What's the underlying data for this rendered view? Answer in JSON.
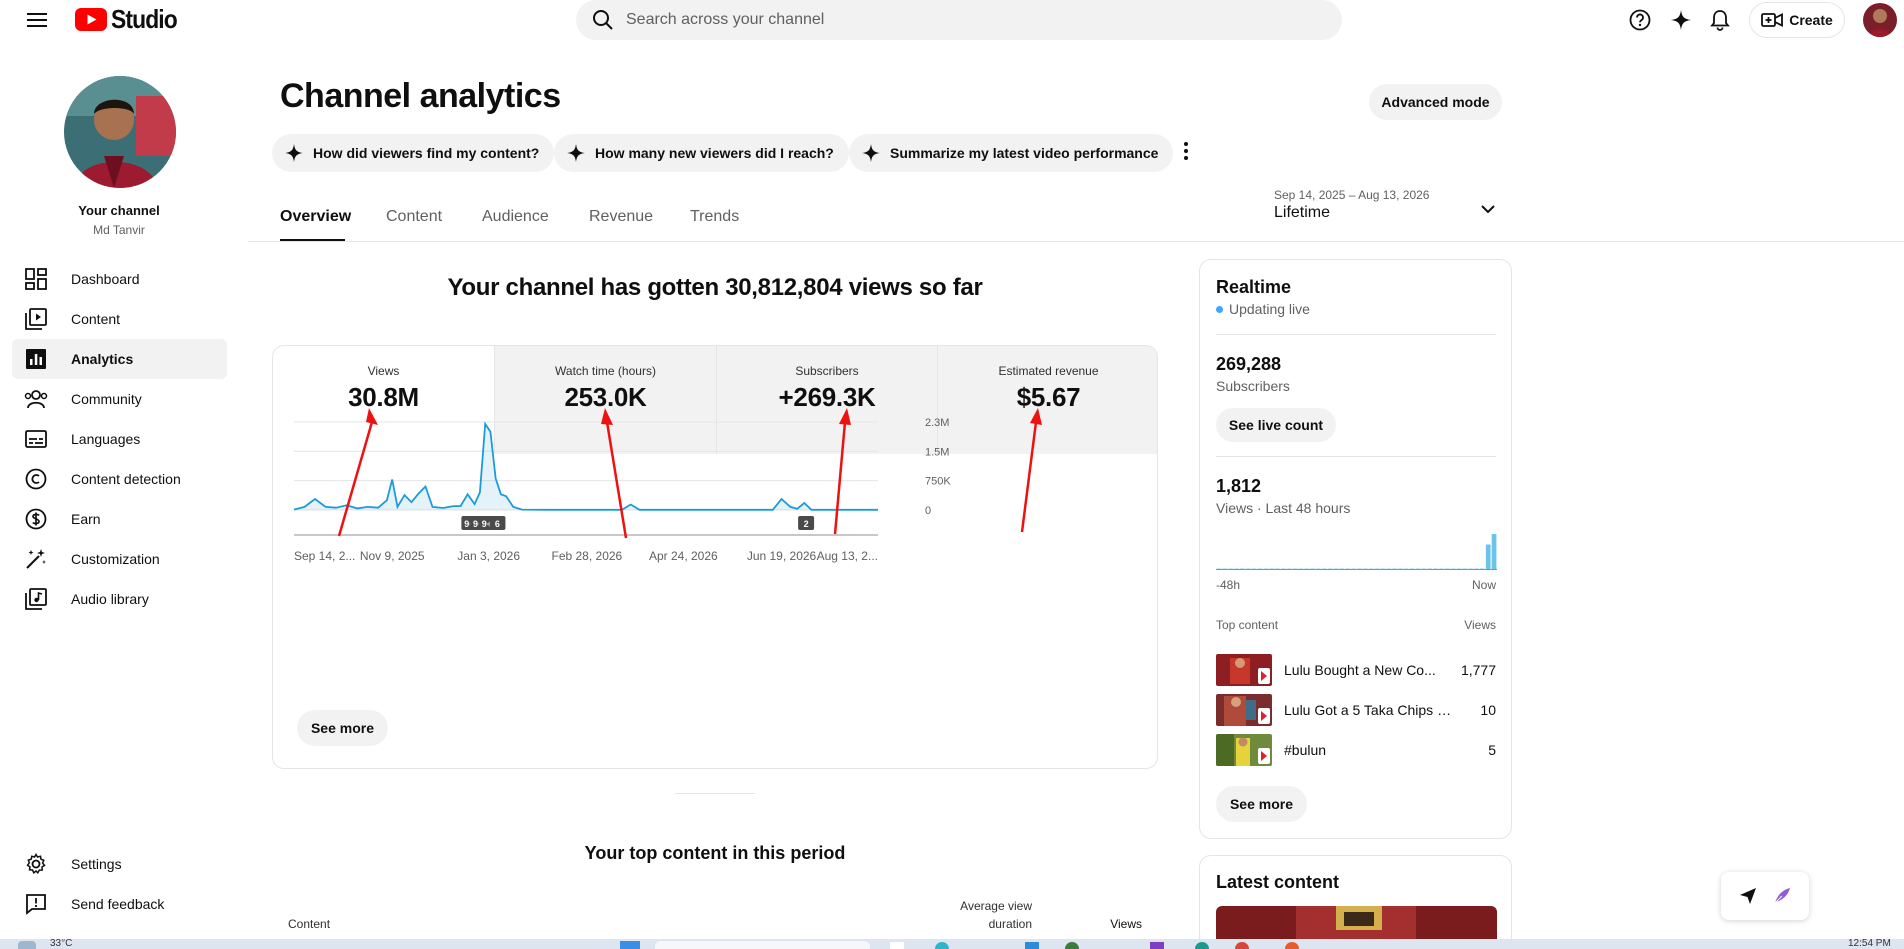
{
  "header": {
    "logo_text": "Studio",
    "search_placeholder": "Search across your channel",
    "create_label": "Create"
  },
  "sidebar": {
    "your_channel": "Your channel",
    "channel_name": "Md Tanvir",
    "items": [
      {
        "label": "Dashboard",
        "icon": "dashboard-icon"
      },
      {
        "label": "Content",
        "icon": "content-icon"
      },
      {
        "label": "Analytics",
        "icon": "analytics-icon",
        "active": true
      },
      {
        "label": "Community",
        "icon": "community-icon"
      },
      {
        "label": "Languages",
        "icon": "languages-icon"
      },
      {
        "label": "Content detection",
        "icon": "copyright-icon"
      },
      {
        "label": "Earn",
        "icon": "dollar-icon"
      },
      {
        "label": "Customization",
        "icon": "magic-wand-icon"
      },
      {
        "label": "Audio library",
        "icon": "audio-library-icon"
      }
    ],
    "settings": "Settings",
    "send_feedback": "Send feedback"
  },
  "main": {
    "title": "Channel analytics",
    "advanced_mode": "Advanced mode",
    "chips": [
      "How did viewers find my content?",
      "How many new viewers did I reach?",
      "Summarize my latest video performance"
    ],
    "tabs": [
      "Overview",
      "Content",
      "Audience",
      "Revenue",
      "Trends"
    ],
    "date_range": "Sep 14, 2025 – Aug 13, 2026",
    "date_label": "Lifetime",
    "headline": "Your channel has gotten 30,812,804 views so far",
    "metrics": [
      {
        "label": "Views",
        "value": "30.8M"
      },
      {
        "label": "Watch time (hours)",
        "value": "253.0K"
      },
      {
        "label": "Subscribers",
        "value": "+269.3K"
      },
      {
        "label": "Estimated revenue",
        "value": "$5.67"
      }
    ],
    "see_more": "See more",
    "top_content_title": "Your top content in this period",
    "table_headers": {
      "content": "Content",
      "avg_duration_1": "Average view",
      "avg_duration_2": "duration",
      "views": "Views"
    }
  },
  "chart_data": {
    "type": "line",
    "x_tick_labels": [
      "Sep 14, 2...",
      "Nov 9, 2025",
      "Jan 3, 2026",
      "Feb 28, 2026",
      "Apr 24, 2026",
      "Jun 19, 2026",
      "Aug 13, 2..."
    ],
    "y_tick_labels": [
      "0",
      "750K",
      "1.5M",
      "2.3M"
    ],
    "ylim": [
      0,
      2300000
    ],
    "series": [
      {
        "color": "#1e9bd7",
        "points": [
          [
            "2025-09-14",
            10000
          ],
          [
            "2025-09-20",
            80000
          ],
          [
            "2025-09-26",
            280000
          ],
          [
            "2025-10-02",
            80000
          ],
          [
            "2025-10-08",
            60000
          ],
          [
            "2025-10-14",
            120000
          ],
          [
            "2025-10-20",
            40000
          ],
          [
            "2025-10-26",
            80000
          ],
          [
            "2025-11-01",
            60000
          ],
          [
            "2025-11-06",
            250000
          ],
          [
            "2025-11-09",
            780000
          ],
          [
            "2025-11-12",
            80000
          ],
          [
            "2025-11-16",
            380000
          ],
          [
            "2025-11-20",
            200000
          ],
          [
            "2025-11-24",
            420000
          ],
          [
            "2025-11-28",
            600000
          ],
          [
            "2025-12-02",
            80000
          ],
          [
            "2025-12-08",
            50000
          ],
          [
            "2025-12-14",
            100000
          ],
          [
            "2025-12-18",
            100000
          ],
          [
            "2025-12-22",
            400000
          ],
          [
            "2025-12-26",
            150000
          ],
          [
            "2025-12-29",
            450000
          ],
          [
            "2026-01-01",
            2200000
          ],
          [
            "2026-01-04",
            2000000
          ],
          [
            "2026-01-07",
            800000
          ],
          [
            "2026-01-10",
            400000
          ],
          [
            "2026-01-13",
            350000
          ],
          [
            "2026-01-17",
            80000
          ],
          [
            "2026-01-22",
            10000
          ],
          [
            "2026-02-05",
            5000
          ],
          [
            "2026-03-01",
            5000
          ],
          [
            "2026-03-20",
            5000
          ],
          [
            "2026-03-25",
            140000
          ],
          [
            "2026-03-30",
            5000
          ],
          [
            "2026-05-10",
            5000
          ],
          [
            "2026-06-14",
            5000
          ],
          [
            "2026-06-19",
            280000
          ],
          [
            "2026-06-24",
            80000
          ],
          [
            "2026-06-28",
            30000
          ],
          [
            "2026-07-02",
            180000
          ],
          [
            "2026-07-06",
            5000
          ],
          [
            "2026-08-13",
            5000
          ]
        ]
      }
    ],
    "annotations": [
      {
        "label": "9+",
        "date": "2025-12-23"
      },
      {
        "label": "9+",
        "date": "2025-12-28"
      },
      {
        "label": "9+",
        "date": "2026-01-02"
      },
      {
        "label": "6",
        "date": "2026-01-08"
      },
      {
        "label": "2",
        "date": "2026-07-03"
      }
    ],
    "grid": true
  },
  "realtime": {
    "title": "Realtime",
    "updating": "Updating live",
    "subscribers_value": "269,288",
    "subscribers_label": "Subscribers",
    "see_live_count": "See live count",
    "views_value": "1,812",
    "views_label": "Views · Last 48 hours",
    "axis_start": "-48h",
    "axis_end": "Now",
    "bars_48h": [
      0.02,
      0.02,
      0.02,
      0.02,
      0.02,
      0.02,
      0.02,
      0.02,
      0.02,
      0.02,
      0.02,
      0.02,
      0.02,
      0.02,
      0.02,
      0.02,
      0.02,
      0.02,
      0.02,
      0.02,
      0.02,
      0.02,
      0.02,
      0.02,
      0.02,
      0.02,
      0.02,
      0.02,
      0.02,
      0.02,
      0.02,
      0.02,
      0.02,
      0.02,
      0.02,
      0.02,
      0.02,
      0.02,
      0.02,
      0.02,
      0.02,
      0.02,
      0.02,
      0.02,
      0.02,
      0.02,
      0.7,
      1.0
    ],
    "top_content_label": "Top content",
    "views_col": "Views",
    "top_content": [
      {
        "title": "Lulu Bought a New Co...",
        "views": "1,777"
      },
      {
        "title": "Lulu Got a 5 Taka Chips Fr...",
        "views": "10"
      },
      {
        "title": "#bulun",
        "views": "5"
      }
    ],
    "see_more": "See more",
    "latest_content": "Latest content"
  },
  "taskbar": {
    "temp": "33°C",
    "time": "12:54 PM"
  },
  "colors": {
    "accent": "#ff0000",
    "chart_line": "#1e9bd7",
    "realtime_bar": "#6cc4ea"
  }
}
